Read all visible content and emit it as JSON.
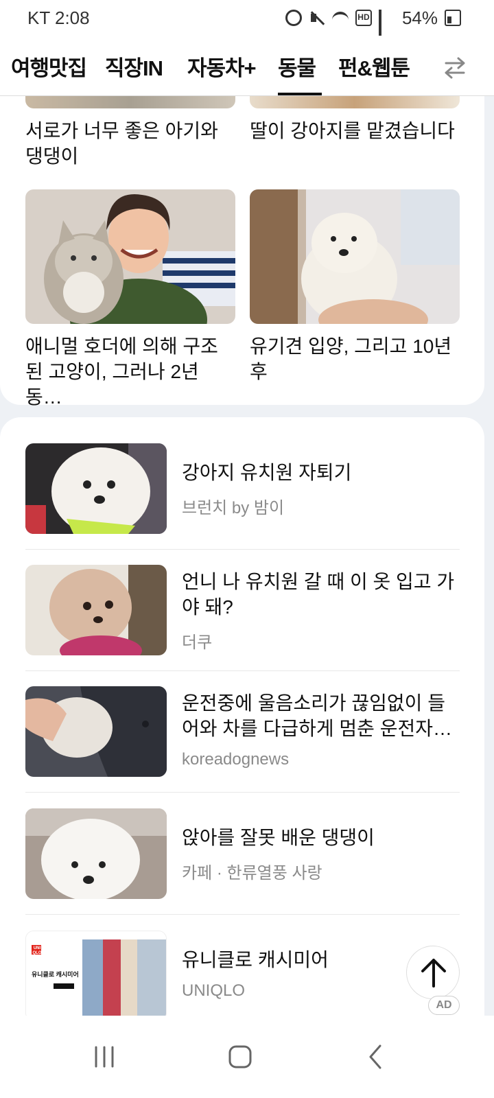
{
  "status_bar": {
    "carrier_time": "KT 2:08",
    "battery": "54%"
  },
  "tabs": [
    {
      "label": "여행맛집"
    },
    {
      "label": "직장IN"
    },
    {
      "label": "자동차+"
    },
    {
      "label": "동물",
      "active": true
    },
    {
      "label": "펀&웹툰"
    }
  ],
  "grid": [
    {
      "title": "서로가 너무 좋은 아기와 댕댕이"
    },
    {
      "title": "딸이 강아지를 맡겼습니다"
    },
    {
      "title": "애니멀 호더에 의해 구조된 고양이, 그러나 2년동…"
    },
    {
      "title": "유기견 입양, 그리고 10년 후"
    }
  ],
  "list": [
    {
      "title": "강아지 유치원 자퇴기",
      "source": "브런치 by 밤이"
    },
    {
      "title": "언니 나 유치원 갈 때 이 옷 입고 가야 돼?",
      "source": "더쿠"
    },
    {
      "title": "운전중에 울음소리가 끊임없이 들어와 차를 다급하게 멈춘 운전자…",
      "source": "koreadognews"
    },
    {
      "title": "앉아를 잘못 배운 댕댕이",
      "source": "카페 · 한류열풍 사랑"
    },
    {
      "title": "유니클로 캐시미어",
      "source": "UNIQLO"
    }
  ],
  "ad": {
    "badge": "AD",
    "banner_brand": "UNI QLO",
    "banner_caption": "유니클로 캐시미어"
  },
  "colors": {
    "accent": "#111111",
    "muted": "#8a8a8a",
    "background": "#eef1f5"
  }
}
